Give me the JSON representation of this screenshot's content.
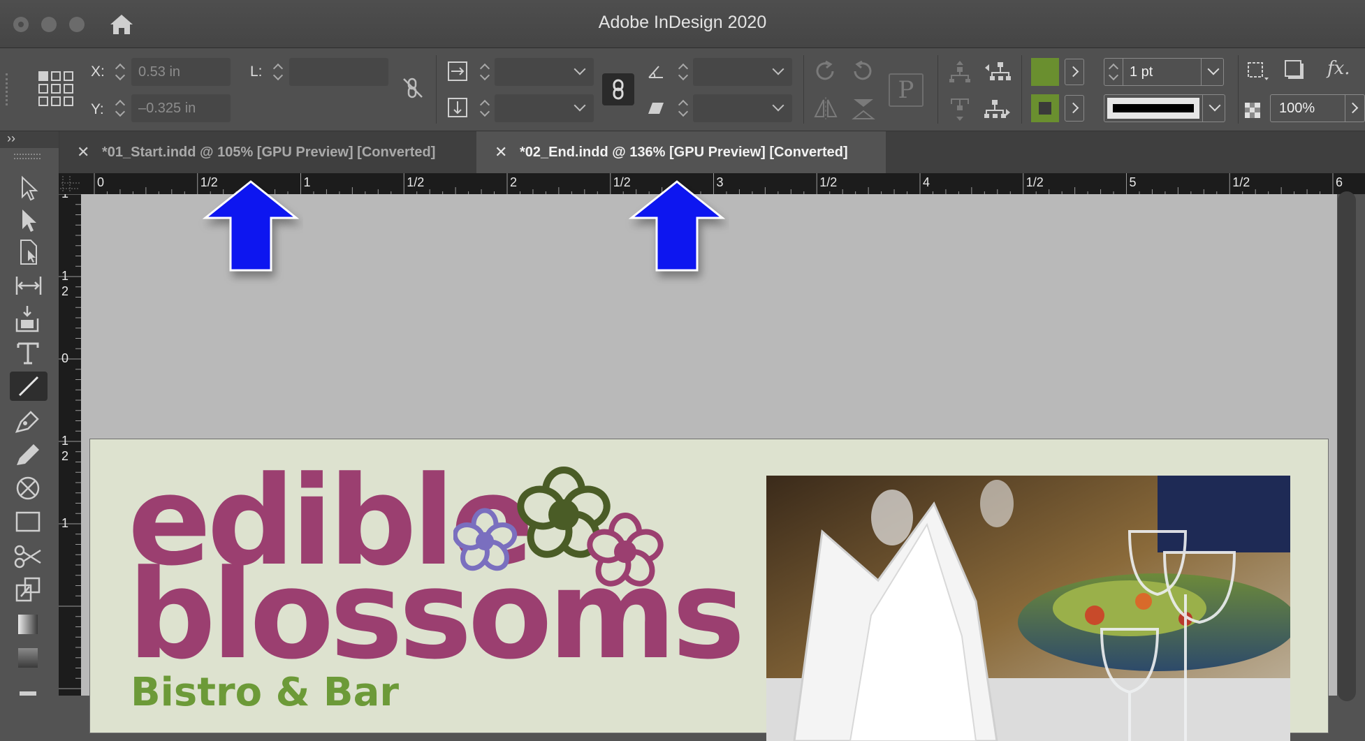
{
  "window": {
    "title": "Adobe InDesign 2020"
  },
  "control_panel": {
    "x_label": "X:",
    "x_value": "0.53 in",
    "y_label": "Y:",
    "y_value": "–0.325 in",
    "l_label": "L:",
    "l_value": "",
    "stroke_weight": "1 pt",
    "opacity": "100%",
    "fill_color": "#6a8f2f",
    "stroke_color": "#6a8f2f",
    "fx_label": "fx."
  },
  "tabs": [
    {
      "label": "*01_Start.indd @ 105% [GPU Preview] [Converted]",
      "active": false
    },
    {
      "label": "*02_End.indd @ 136% [GPU Preview] [Converted]",
      "active": true
    }
  ],
  "toolbox": {
    "collapse_label": "››",
    "tools": [
      "selection-tool",
      "direct-selection-tool",
      "page-tool",
      "gap-tool",
      "content-collector-tool",
      "type-tool",
      "line-tool",
      "pen-tool",
      "pencil-tool",
      "rectangle-frame-tool",
      "rectangle-tool",
      "scissors-tool",
      "free-transform-tool",
      "gradient-swatch-tool",
      "gradient-feather-tool"
    ],
    "selected_tool": "line-tool"
  },
  "ruler_top": {
    "labels": [
      "0",
      "1/2",
      "1",
      "1/2",
      "2",
      "1/2",
      "3",
      "1/2",
      "4",
      "1/2",
      "5",
      "1/2",
      "6"
    ]
  },
  "ruler_left": {
    "labels": [
      "1",
      "1\n2",
      "0",
      "1\n2",
      "1"
    ]
  },
  "document": {
    "logo_line1": "edible",
    "logo_line2": "blossoms",
    "tagline": "Bistro & Bar",
    "logo_color": "#9b3f70",
    "tagline_color": "#6c9a38",
    "page_color": "#dde2cf"
  },
  "annotations": {
    "arrow_color": "#0a14f0",
    "arrow_count": 2
  }
}
